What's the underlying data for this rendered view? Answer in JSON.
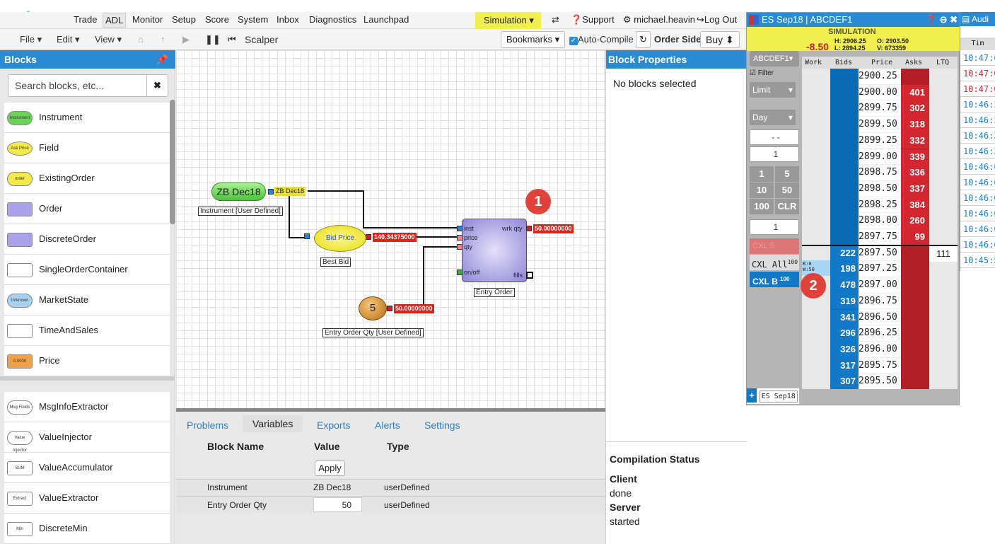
{
  "topnav": {
    "items": [
      "Trade",
      "ADL",
      "Monitor",
      "Setup",
      "Score",
      "System",
      "Inbox",
      "Diagnostics",
      "Launchpad"
    ],
    "simulation": "Simulation",
    "support": "Support",
    "user": "michael.heavin",
    "logout": "Log Out"
  },
  "toolbar": {
    "file": "File",
    "edit": "Edit",
    "view": "View",
    "name": "Scalper",
    "bookmarks": "Bookmarks",
    "auto_compile": "Auto-Compile",
    "order_side_label": "Order Side",
    "order_side": "Buy"
  },
  "sidebar": {
    "title": "Blocks",
    "search_placeholder": "Search blocks, etc...",
    "items": [
      {
        "label": "Instrument",
        "icon": "Instrument"
      },
      {
        "label": "Field",
        "icon": "Ask Price"
      },
      {
        "label": "ExistingOrder",
        "icon": "order"
      },
      {
        "label": "Order",
        "icon": ""
      },
      {
        "label": "DiscreteOrder",
        "icon": ""
      },
      {
        "label": "SingleOrderContainer",
        "icon": ""
      },
      {
        "label": "MarketState",
        "icon": "Unknown"
      },
      {
        "label": "TimeAndSales",
        "icon": ""
      },
      {
        "label": "Price",
        "icon": "0.0000"
      },
      {
        "label": "MsgInfoExtractor",
        "icon": "Msg Fields"
      },
      {
        "label": "ValueInjector",
        "icon": "Value Injector"
      },
      {
        "label": "ValueAccumulator",
        "icon": "SUM"
      },
      {
        "label": "ValueExtractor",
        "icon": "Extract"
      },
      {
        "label": "DiscreteMin",
        "icon": "Min"
      }
    ]
  },
  "canvas": {
    "instrument": {
      "name": "ZB Dec18",
      "caption": "Instrument [User Defined]",
      "out": "ZB Dec18"
    },
    "field": {
      "name": "Bid Price",
      "caption": "Best Bid",
      "out": "140.34375000"
    },
    "qty": {
      "name": "5",
      "caption": "Entry Order Qty [User Defined]",
      "out": "50.00000000"
    },
    "order": {
      "caption": "Entry Order",
      "ports": [
        "inst",
        "price",
        "qty",
        "on/off"
      ],
      "wrk": "wrk qty",
      "fills": "fills",
      "out": "50.00000000"
    },
    "markers": [
      "1",
      "2"
    ]
  },
  "bottom": {
    "tabs": [
      "Problems",
      "Variables",
      "Exports",
      "Alerts",
      "Settings"
    ],
    "headers": [
      "Block Name",
      "Value",
      "Type"
    ],
    "apply": "Apply",
    "rows": [
      {
        "name": "Instrument",
        "value": "ZB Dec18",
        "type": "userDefined"
      },
      {
        "name": "Entry Order Qty",
        "value": "50",
        "type": "userDefined"
      }
    ]
  },
  "props": {
    "title": "Block Properties",
    "empty": "No blocks selected",
    "compilation_title": "Compilation Status",
    "client_label": "Client",
    "client_status": "done",
    "server_label": "Server",
    "server_status": "started"
  },
  "ladder": {
    "title": "ES Sep18 | ABCDEF1",
    "sim": "SIMULATION",
    "change": "-8.50",
    "high": "H: 2906.25",
    "open": "O: 2903.50",
    "low": "L: 2894.25",
    "volume": "V: 673359",
    "account": "ABCDEF1",
    "filter": "Filter",
    "order_type": "Limit",
    "tif": "Day",
    "blank": "- -",
    "qty_small": "1",
    "qty_big": "1",
    "qtybtns": [
      [
        "1",
        "5"
      ],
      [
        "10",
        "50"
      ],
      [
        "100",
        "CLR"
      ]
    ],
    "cxl_s": "CXL S",
    "cxl_all": "CXL All",
    "cxl_all_num": "100",
    "cxl_b": "CXL B",
    "cxl_b_num": "100",
    "work_note_b": "B:0",
    "work_note_w": "W:50",
    "headers": [
      "Work",
      "Bids",
      "Price",
      "Asks",
      "LTQ"
    ],
    "prices": [
      "2900.25",
      "2900.00",
      "2899.75",
      "2899.50",
      "2899.25",
      "2899.00",
      "2898.75",
      "2898.50",
      "2898.25",
      "2898.00",
      "2897.75",
      "2897.50",
      "2897.25",
      "2897.00",
      "2896.75",
      "2896.50",
      "2896.25",
      "2896.00",
      "2895.75",
      "2895.50"
    ],
    "asks": [
      "",
      "401",
      "302",
      "318",
      "332",
      "339",
      "336",
      "337",
      "384",
      "260",
      "99",
      "",
      "",
      "",
      "",
      "",
      "",
      "",
      "",
      ""
    ],
    "bids": [
      "",
      "",
      "",
      "",
      "",
      "",
      "",
      "",
      "",
      "",
      "",
      "222",
      "198",
      "478",
      "319",
      "341",
      "296",
      "326",
      "317",
      "307"
    ],
    "ltq": "111",
    "tab": "ES Sep18"
  },
  "audit": {
    "title": "Audi",
    "header": "Tim",
    "times": [
      "10:47:0",
      "10:47:0",
      "10:47:0",
      "10:46:3",
      "10:46:3",
      "10:46:3",
      "10:46:3",
      "10:46:0",
      "10:46:0",
      "10:46:0",
      "10:46:0",
      "10:46:0",
      "10:46:0",
      "10:45:5"
    ]
  }
}
